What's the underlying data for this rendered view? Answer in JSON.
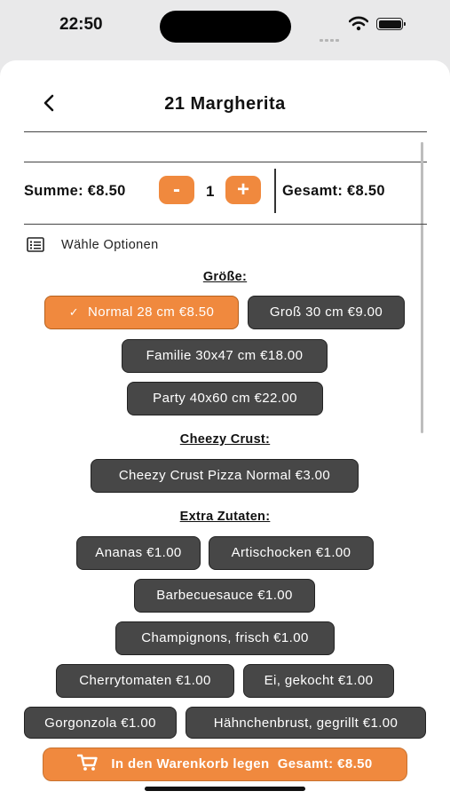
{
  "status": {
    "time": "22:50"
  },
  "header": {
    "title": "21 Margherita"
  },
  "quantity": {
    "summe_label": "Summe: €8.50",
    "minus": "-",
    "value": "1",
    "plus": "+",
    "gesamt_label": "Gesamt: €8.50"
  },
  "options_label": "Wähle Optionen",
  "sections": {
    "size_title": "Größe:",
    "size_options": [
      "Normal 28 cm €8.50",
      "Groß 30 cm €9.00",
      "Familie 30x47 cm €18.00",
      "Party 40x60 cm €22.00"
    ],
    "crust_title": "Cheezy Crust:",
    "crust_options": [
      "Cheezy Crust Pizza Normal €3.00"
    ],
    "extras_title": "Extra Zutaten:",
    "extras_options": [
      "Ananas €1.00",
      "Artischocken €1.00",
      "Barbecuesauce €1.00",
      "Champignons, frisch €1.00",
      "Cherrytomaten €1.00",
      "Ei, gekocht €1.00",
      "Gorgonzola €1.00",
      "Hähnchenbrust, gegrillt €1.00"
    ]
  },
  "cart_button": {
    "label": "In den Warenkorb legen",
    "total": "Gesamt: €8.50"
  },
  "colors": {
    "accent": "#f0893e",
    "chip": "#474747",
    "background": "#ffffff"
  },
  "icons": {
    "back": "chevron-left-icon",
    "options": "list-icon",
    "cart": "cart-icon",
    "check": "checkmark-icon"
  }
}
